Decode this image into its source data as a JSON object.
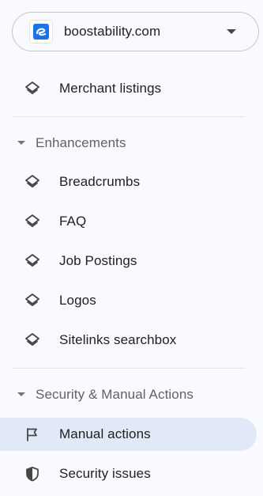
{
  "property": {
    "name": "boostability.com",
    "logo_icon": "boostability-logo-icon",
    "logo_color": "#1a73e8"
  },
  "items": {
    "merchant_listings": {
      "label": "Merchant listings",
      "icon": "layers-icon"
    },
    "breadcrumbs": {
      "label": "Breadcrumbs",
      "icon": "layers-icon"
    },
    "faq": {
      "label": "FAQ",
      "icon": "layers-icon"
    },
    "job_postings": {
      "label": "Job Postings",
      "icon": "layers-icon"
    },
    "logos": {
      "label": "Logos",
      "icon": "layers-icon"
    },
    "sitelinks": {
      "label": "Sitelinks searchbox",
      "icon": "layers-icon"
    },
    "manual_actions": {
      "label": "Manual actions",
      "icon": "flag-icon",
      "active": true
    },
    "security_issues": {
      "label": "Security issues",
      "icon": "shield-icon"
    }
  },
  "sections": {
    "enhancements": {
      "label": "Enhancements",
      "expanded": true
    },
    "security": {
      "label": "Security & Manual Actions",
      "expanded": true
    }
  },
  "colors": {
    "active_bg": "#e1e9f9",
    "background": "#f8fafd",
    "icon": "#444746"
  }
}
